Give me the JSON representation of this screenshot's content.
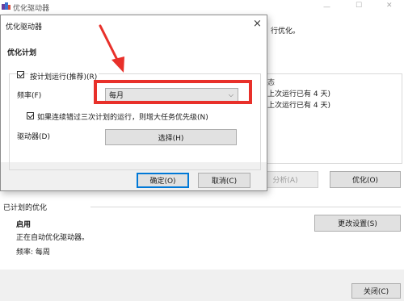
{
  "background_window": {
    "title": "优化驱动器",
    "intro_text_fragment": "行优化。",
    "list_header_fragment": "态",
    "list_rows": [
      "上次运行已有 4 天)",
      "上次运行已有 4 天)"
    ],
    "analyze_label": "分析(A)",
    "optimize_label": "优化(O)",
    "scheduled_section_label": "已计划的优化",
    "schedule_status_title": "启用",
    "schedule_status_text": "正在自动优化驱动器。",
    "schedule_frequency_text": "频率: 每周",
    "change_settings_label": "更改设置(S)",
    "close_label": "关闭(C)"
  },
  "dialog": {
    "title": "优化驱动器",
    "close_glyph": "×",
    "section_heading": "优化计划",
    "run_on_schedule_label": "按计划运行(推荐)(R)",
    "run_on_schedule_checked": true,
    "frequency_label": "频率(F)",
    "frequency_value": "每月",
    "increase_priority_label": "如果连续错过三次计划的运行，则增大任务优先级(N)",
    "increase_priority_checked": true,
    "drives_label": "驱动器(D)",
    "choose_label": "选择(H)",
    "ok_label": "确定(O)",
    "cancel_label": "取消(C)"
  },
  "annotation": {
    "color": "#e8302a"
  },
  "icons": {
    "app_icon": "defrag-app-icon",
    "dropdown": "chevron-down-icon",
    "close": "close-icon"
  }
}
